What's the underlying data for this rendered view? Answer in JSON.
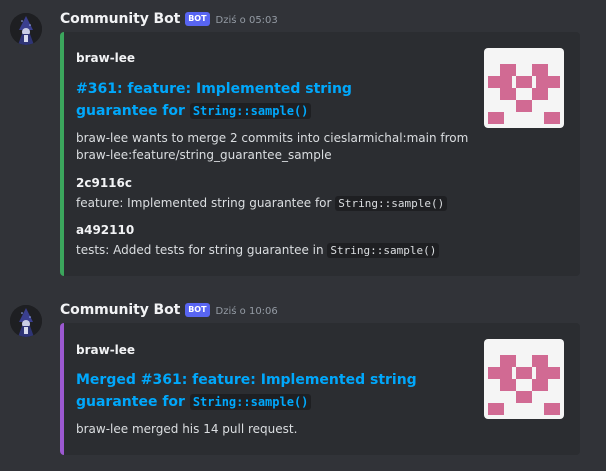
{
  "messages": [
    {
      "username": "Community Bot",
      "badge": "BOT",
      "timestamp": "Dziś o 05:03",
      "embed": {
        "accent_color": "#3ba55c",
        "author": "braw-lee",
        "title_prefix": "#361: feature: Implemented string guarantee for",
        "title_code": "String::sample()",
        "description_line1": "braw-lee wants to merge 2 commits into cieslarmichal:main from",
        "description_line2": "braw-lee:feature/string_guarantee_sample",
        "fields": [
          {
            "name": "2c9116c",
            "value_prefix": "feature: Implemented string guarantee for ",
            "value_code": "String::sample()"
          },
          {
            "name": "a492110",
            "value_prefix": "tests: Added tests for string guarantee in ",
            "value_code": "String::sample()"
          }
        ]
      }
    },
    {
      "username": "Community Bot",
      "badge": "BOT",
      "timestamp": "Dziś o 10:06",
      "embed": {
        "accent_color": "#9c59d1",
        "author": "braw-lee",
        "title_line1": "Merged #361: feature: Implemented string guarantee",
        "title_prefix2": "for",
        "title_code": "String::sample()",
        "description": "braw-lee merged his 14 pull request."
      }
    }
  ],
  "icons": {
    "avatar": "wizard-avatar-icon",
    "thumbnail": "pink-identicon"
  },
  "colors": {
    "background": "#313338",
    "embed_bg": "#2b2d31",
    "link": "#00a8fc",
    "badge": "#5865f2",
    "identicon": "#d16a93"
  }
}
